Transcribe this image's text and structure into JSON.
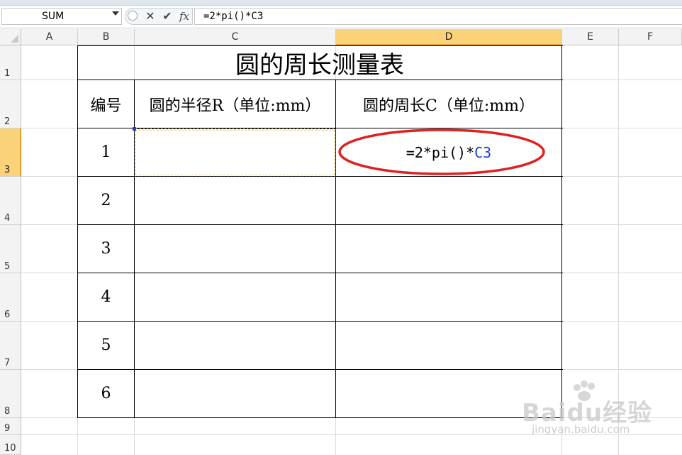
{
  "formula_bar": {
    "name_box": "SUM",
    "cancel_icon": "cancel-icon",
    "enter_icon": "check-icon",
    "function_icon": "fx-icon",
    "function_label": "fx",
    "formula": "=2*pi()*C3"
  },
  "columns": [
    "A",
    "B",
    "C",
    "D",
    "E",
    "F"
  ],
  "selected_column": "D",
  "rows": [
    "1",
    "2",
    "3",
    "4",
    "5",
    "6",
    "7",
    "8",
    "9",
    "10"
  ],
  "selected_row": "3",
  "table": {
    "title": "圆的周长测量表",
    "header_no": "编号",
    "header_radius": "圆的半径R（单位:mm）",
    "header_circumference": "圆的周长C（单位:mm）",
    "row_numbers": [
      "1",
      "2",
      "3",
      "4",
      "5",
      "6"
    ],
    "formula_text_part": "=2*pi()*",
    "formula_ref_part": "C3"
  },
  "colors": {
    "selected_header": "#f9d27a",
    "ellipse": "#e02020",
    "cell_reference": "#1a3fd6"
  },
  "watermark": {
    "logo": "Baidu经验",
    "sub": "jingyan.baidu.com"
  }
}
